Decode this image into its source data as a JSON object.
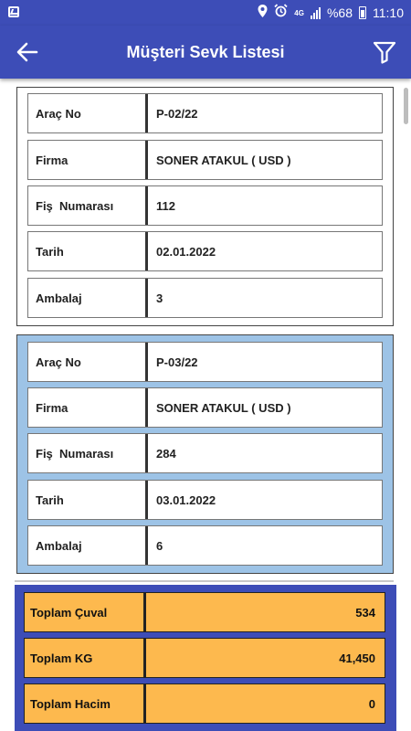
{
  "status_bar": {
    "network": "4G",
    "battery": "%68",
    "time": "11:10"
  },
  "header": {
    "title": "Müşteri Sevk Listesi",
    "color": "#3d4db7"
  },
  "shipments": [
    {
      "fields": [
        {
          "label": "Araç No",
          "value": "P-02/22"
        },
        {
          "label": "Firma",
          "value": "SONER ATAKUL ( USD )"
        },
        {
          "label": "Fiş  Numarası",
          "value": "112"
        },
        {
          "label": "Tarih",
          "value": "02.01.2022"
        },
        {
          "label": "Ambalaj",
          "value": "3"
        }
      ]
    },
    {
      "fields": [
        {
          "label": "Araç No",
          "value": "P-03/22"
        },
        {
          "label": "Firma",
          "value": "SONER ATAKUL ( USD )"
        },
        {
          "label": "Fiş  Numarası",
          "value": "284"
        },
        {
          "label": "Tarih",
          "value": "03.01.2022"
        },
        {
          "label": "Ambalaj",
          "value": "6"
        }
      ]
    }
  ],
  "totals": [
    {
      "label": "Toplam Çuval",
      "value": "534"
    },
    {
      "label": "Toplam KG",
      "value": "41,450"
    },
    {
      "label": "Toplam Hacim",
      "value": "0"
    }
  ],
  "colors": {
    "selected_card": "#9dc3e6",
    "totals_row": "#fdb94e"
  }
}
